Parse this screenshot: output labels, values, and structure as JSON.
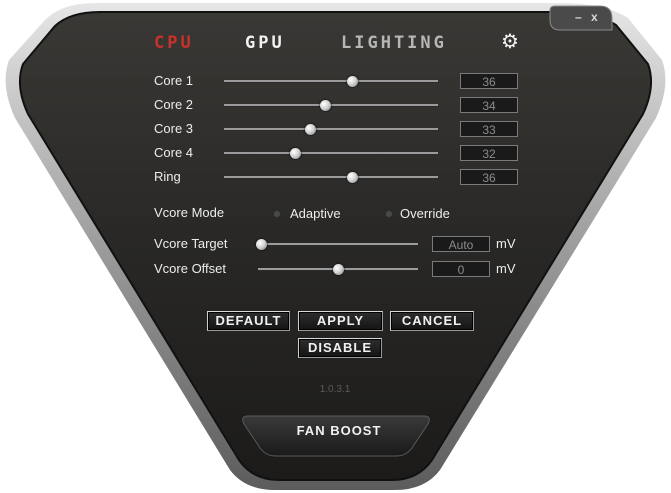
{
  "window": {
    "minimize_label": "–",
    "close_label": "x"
  },
  "tabs": [
    {
      "label": "CPU",
      "active": true
    },
    {
      "label": "GPU",
      "active": false
    },
    {
      "label": "LIGHTING",
      "active": false
    }
  ],
  "settings_icon": "gear-icon",
  "cores": [
    {
      "label": "Core 1",
      "value": "36",
      "level": 0.6
    },
    {
      "label": "Core 2",
      "value": "34",
      "level": 0.47
    },
    {
      "label": "Core 3",
      "value": "33",
      "level": 0.4
    },
    {
      "label": "Core 4",
      "value": "32",
      "level": 0.33
    },
    {
      "label": "Ring",
      "value": "36",
      "level": 0.6
    }
  ],
  "vcore_mode": {
    "label": "Vcore Mode",
    "options": [
      "Adaptive",
      "Override"
    ]
  },
  "vcore_target": {
    "label": "Vcore Target",
    "value": "Auto",
    "unit": "mV",
    "level": 0.02
  },
  "vcore_offset": {
    "label": "Vcore Offset",
    "value": "0",
    "unit": "mV",
    "level": 0.5
  },
  "buttons": {
    "default": "DEFAULT",
    "apply": "APPLY",
    "cancel": "CANCEL",
    "disable": "DISABLE"
  },
  "version": "1.0.3.1",
  "fan_boost": "FAN BOOST",
  "colors": {
    "active_tab": "#c9312b",
    "panel": "#2a2a2a",
    "bezel": "#bdbdbd"
  }
}
